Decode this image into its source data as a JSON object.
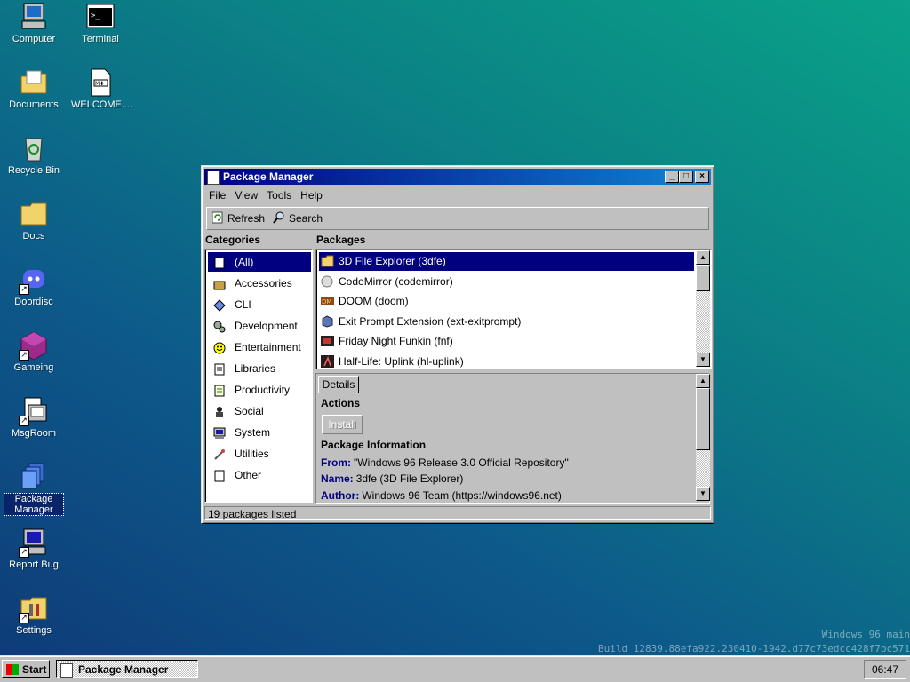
{
  "desktop": {
    "icons": [
      {
        "label": "Computer",
        "icon": "computer-icon"
      },
      {
        "label": "Terminal",
        "icon": "terminal-icon"
      },
      {
        "label": "Documents",
        "icon": "documents-folder-icon"
      },
      {
        "label": "WELCOME....",
        "icon": "markdown-file-icon"
      },
      {
        "label": "Recycle Bin",
        "icon": "recycle-bin-icon"
      },
      {
        "label": "Docs",
        "icon": "folder-icon"
      },
      {
        "label": "Doordisc",
        "icon": "discord-icon"
      },
      {
        "label": "Gameing",
        "icon": "game-cube-icon"
      },
      {
        "label": "MsgRoom",
        "icon": "msgroom-icon"
      },
      {
        "label": "Package Manager",
        "icon": "package-manager-icon"
      },
      {
        "label": "Report Bug",
        "icon": "report-bug-icon"
      },
      {
        "label": "Settings",
        "icon": "settings-icon"
      }
    ]
  },
  "window": {
    "title": "Package Manager",
    "menu": [
      "File",
      "View",
      "Tools",
      "Help"
    ],
    "toolbar": {
      "refresh": "Refresh",
      "search": "Search"
    },
    "categories_header": "Categories",
    "packages_header": "Packages",
    "categories": [
      "(All)",
      "Accessories",
      "CLI",
      "Development",
      "Entertainment",
      "Libraries",
      "Productivity",
      "Social",
      "System",
      "Utilities",
      "Other"
    ],
    "packages": [
      "3D File Explorer (3dfe)",
      "CodeMirror (codemirror)",
      "DOOM (doom)",
      "Exit Prompt Extension (ext-exitprompt)",
      "Friday Night Funkin (fnf)",
      "Half-Life: Uplink (hl-uplink)"
    ],
    "details": {
      "tab": "Details",
      "actions_title": "Actions",
      "install_label": "Install",
      "info_title": "Package Information",
      "from_label": "From:",
      "from_value": "\"Windows 96 Release 3.0 Official Repository\"",
      "name_label": "Name:",
      "name_value": "3dfe (3D File Explorer)",
      "author_label": "Author:",
      "author_value": "Windows 96 Team (https://windows96.net)"
    },
    "status": "19 packages listed"
  },
  "taskbar": {
    "start": "Start",
    "task": "Package Manager",
    "clock": "06:47"
  },
  "watermark": {
    "line1": "Windows 96 main",
    "line2": "Build 12839.88efa922.230410-1942.d77c73edcc428f7bc571"
  },
  "colors": {
    "selection": "#000080",
    "window": "#c0c0c0",
    "title_start": "#000080",
    "title_end": "#1084d0"
  }
}
